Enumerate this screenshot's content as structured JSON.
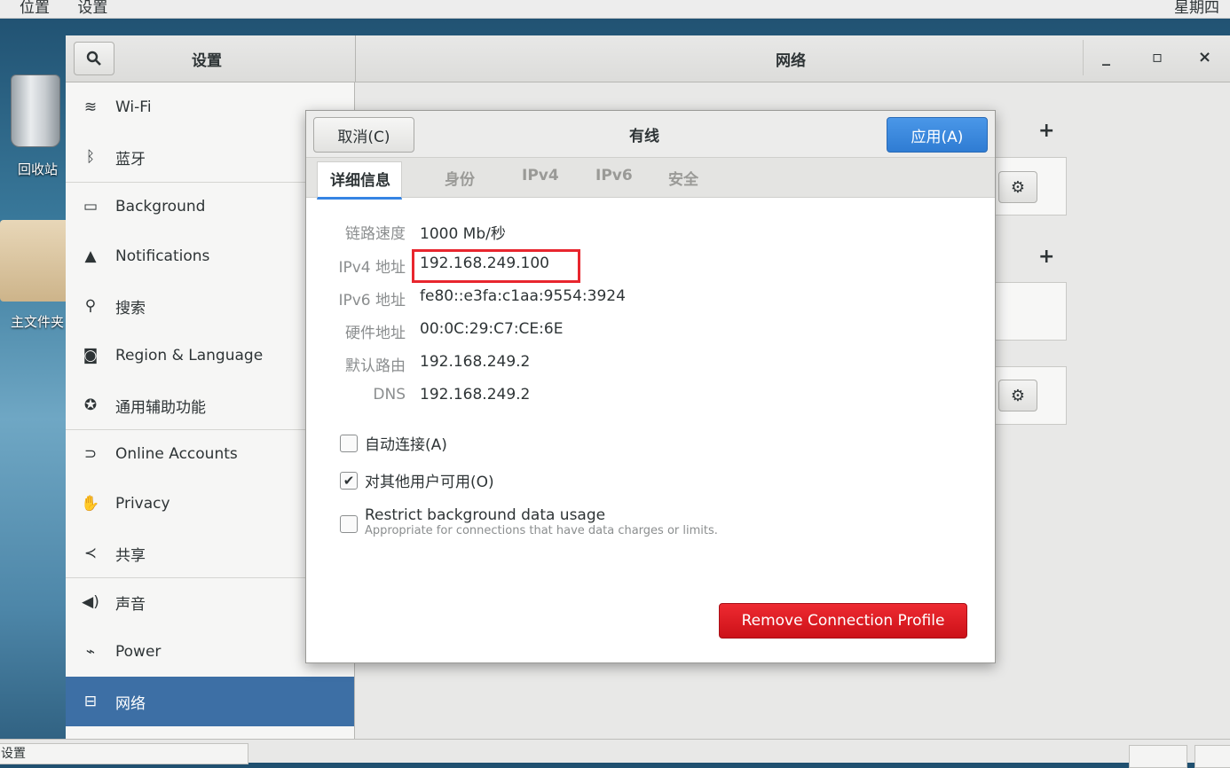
{
  "topbar": {
    "menu_places": "位置",
    "menu_settings": "设置",
    "clock": "星期四"
  },
  "desktop": {
    "trash_label": "回收站",
    "home_label": "主文件夹"
  },
  "window": {
    "sidebar_title": "设置",
    "title": "网络",
    "minimize": "_",
    "maximize": "▫",
    "close": "×"
  },
  "sidebar": {
    "items": [
      {
        "label": "Wi-Fi",
        "icon": "wifi-icon"
      },
      {
        "label": "蓝牙",
        "icon": "bluetooth-icon"
      },
      {
        "label": "Background",
        "icon": "display-icon"
      },
      {
        "label": "Notifications",
        "icon": "bell-icon"
      },
      {
        "label": "搜索",
        "icon": "search-icon"
      },
      {
        "label": "Region & Language",
        "icon": "camera-icon"
      },
      {
        "label": "通用辅助功能",
        "icon": "accessibility-icon"
      },
      {
        "label": "Online Accounts",
        "icon": "online-accounts-icon"
      },
      {
        "label": "Privacy",
        "icon": "hand-icon"
      },
      {
        "label": "共享",
        "icon": "share-icon"
      },
      {
        "label": "声音",
        "icon": "speaker-icon"
      },
      {
        "label": "Power",
        "icon": "power-icon"
      },
      {
        "label": "网络",
        "icon": "network-icon"
      }
    ],
    "active": "网络"
  },
  "dialog": {
    "cancel": "取消(C)",
    "title": "有线",
    "apply": "应用(A)",
    "tabs": [
      "详细信息",
      "身份",
      "IPv4",
      "IPv6",
      "安全"
    ],
    "active_tab": "详细信息",
    "details": [
      {
        "label": "链路速度",
        "value": "1000 Mb/秒"
      },
      {
        "label": "IPv4 地址",
        "value": "192.168.249.100"
      },
      {
        "label": "IPv6 地址",
        "value": "fe80::e3fa:c1aa:9554:3924"
      },
      {
        "label": "硬件地址",
        "value": "00:0C:29:C7:CE:6E"
      },
      {
        "label": "默认路由",
        "value": "192.168.249.2"
      },
      {
        "label": "DNS",
        "value": "192.168.249.2"
      }
    ],
    "auto_connect": {
      "label": "自动连接(A)",
      "checked": false
    },
    "available_all": {
      "label": "对其他用户可用(O)",
      "checked": true
    },
    "restrict": {
      "label": "Restrict background data usage",
      "hint": "Appropriate for connections that have data charges or limits.",
      "checked": false
    },
    "remove": "Remove Connection Profile"
  },
  "taskbar": {
    "item": "设置"
  },
  "colors": {
    "accent": "#3584e4",
    "destructive": "#e01b24",
    "sidebar_active": "#3d6fa5",
    "highlight": "#e8262e"
  }
}
